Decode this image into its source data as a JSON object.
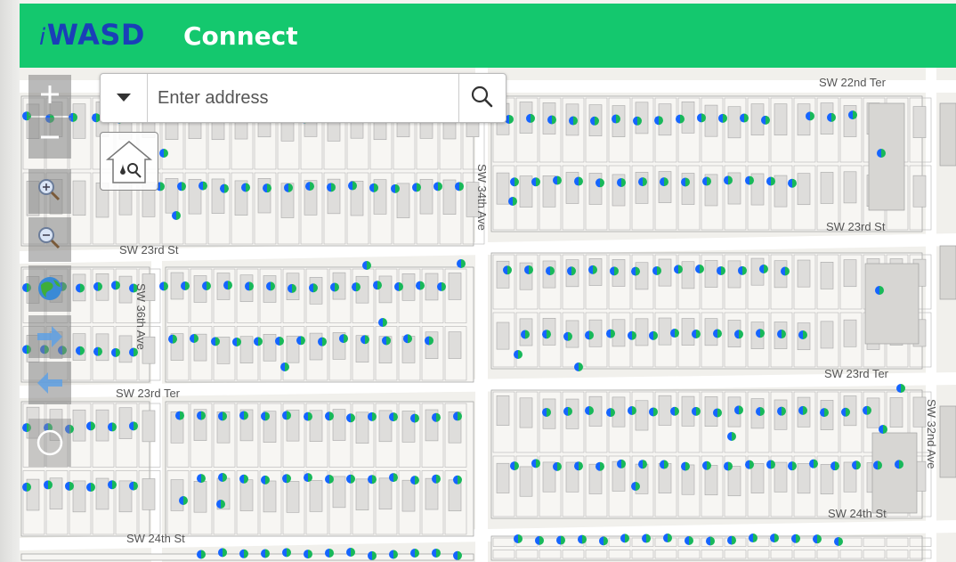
{
  "header": {
    "logo_prefix": "i",
    "logo_text": "WASD",
    "app_name": "Connect",
    "bg_color": "#14c86e",
    "logo_color": "#1a3fb8"
  },
  "search": {
    "placeholder": "Enter address",
    "value": ""
  },
  "toolbar": {
    "tools": [
      {
        "name": "zoom-in",
        "icon": "plus-icon"
      },
      {
        "name": "zoom-out",
        "icon": "minus-icon"
      },
      {
        "name": "zoom-in-box",
        "icon": "magnifier-plus-icon"
      },
      {
        "name": "zoom-out-box",
        "icon": "magnifier-minus-icon"
      },
      {
        "name": "full-extent",
        "icon": "globe-icon"
      },
      {
        "name": "next-extent",
        "icon": "arrow-right-icon"
      },
      {
        "name": "previous-extent",
        "icon": "arrow-left-icon"
      },
      {
        "name": "locate",
        "icon": "circle-icon"
      }
    ]
  },
  "home_widget": {
    "icon": "house-meter-icon"
  },
  "streets": {
    "sw_22nd_ter": "SW 22nd Ter",
    "sw_23rd_st_left": "SW 23rd St",
    "sw_23rd_st_right": "SW 23rd St",
    "sw_23rd_ter_left": "SW 23rd Ter",
    "sw_23rd_ter_right": "SW 23rd Ter",
    "sw_24th_st_left": "SW 24th St",
    "sw_24th_st_right": "SW 24th St",
    "sw_34th_ave": "SW 34th Ave",
    "sw_36th_ave": "SW 36th Ave",
    "sw_32nd_ave": "SW 32nd Ave"
  },
  "markers": {
    "color_a": "#1565ff",
    "color_b": "#18b85a"
  }
}
